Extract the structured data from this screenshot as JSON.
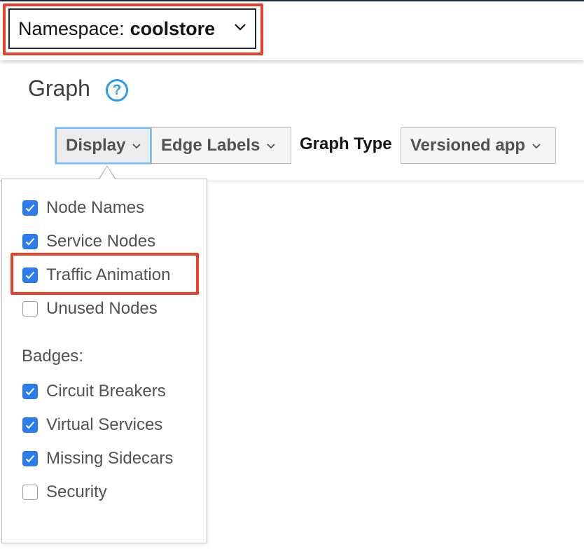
{
  "namespace": {
    "prefix": "Namespace:",
    "value": "coolstore"
  },
  "page": {
    "title": "Graph",
    "help_icon": "?"
  },
  "toolbar": {
    "display_label": "Display",
    "edge_labels_label": "Edge Labels",
    "graph_type_label": "Graph Type",
    "graph_type_value": "Versioned app"
  },
  "display_menu": {
    "options": [
      {
        "label": "Node Names",
        "checked": true
      },
      {
        "label": "Service Nodes",
        "checked": true
      },
      {
        "label": "Traffic Animation",
        "checked": true
      },
      {
        "label": "Unused Nodes",
        "checked": false
      }
    ],
    "badges_label": "Badges:",
    "badges": [
      {
        "label": "Circuit Breakers",
        "checked": true
      },
      {
        "label": "Virtual Services",
        "checked": true
      },
      {
        "label": "Missing Sidecars",
        "checked": true
      },
      {
        "label": "Security",
        "checked": false
      }
    ]
  },
  "colors": {
    "highlight": "#e8412b",
    "checkbox_checked": "#2b7de9",
    "help_icon": "#2b9af3",
    "display_button_focus": "#73bcf7"
  },
  "icons": {
    "chevron": "chevron-down-icon",
    "help": "help-icon",
    "check": "check-icon"
  }
}
